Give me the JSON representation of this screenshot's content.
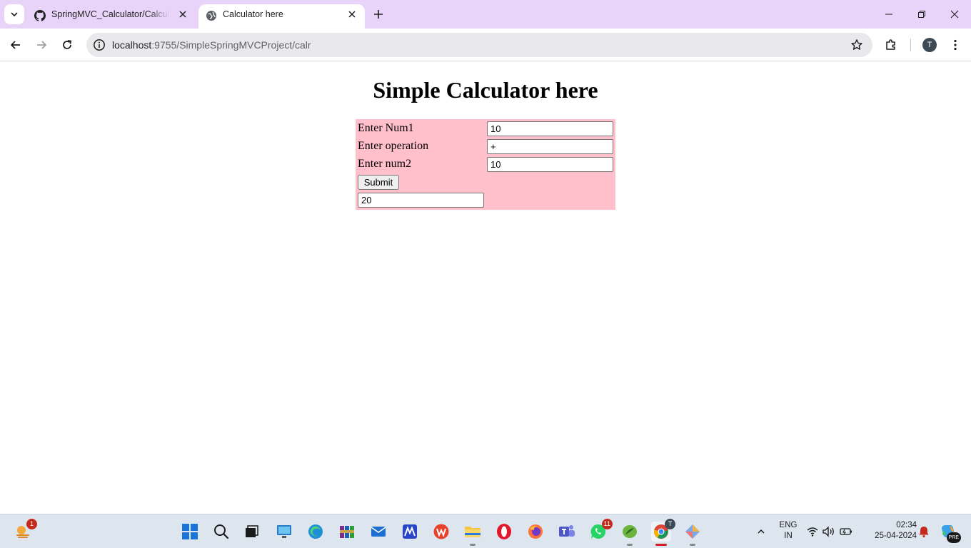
{
  "browser": {
    "tabs": [
      {
        "title": "SpringMVC_Calculator/Calcula",
        "icon": "github-icon",
        "active": false
      },
      {
        "title": "Calculator here",
        "icon": "globe-icon",
        "active": true
      }
    ],
    "address_bar": {
      "url_host": "localhost",
      "url_path": ":9755/SimpleSpringMVCProject/calr"
    },
    "profile_initial": "T"
  },
  "page": {
    "heading": "Simple Calculator here",
    "form": {
      "background_color": "#ffc0cb",
      "num1_label": "Enter Num1",
      "num1_value": "10",
      "operation_label": "Enter operation",
      "operation_value": "+",
      "num2_label": "Enter num2",
      "num2_value": "10",
      "submit_label": "Submit",
      "result_value": "20"
    }
  },
  "taskbar": {
    "widgets_badge": "1",
    "whatsapp_badge": "11",
    "chrome_overlay": "T",
    "language_line1": "ENG",
    "language_line2": "IN",
    "time": "02:34",
    "date": "25-04-2024",
    "copilot_label": "PRE"
  },
  "colors": {
    "tabstrip": "#e8d4f8",
    "taskbar": "#dde6ee",
    "form_background": "#ffc0cb"
  }
}
